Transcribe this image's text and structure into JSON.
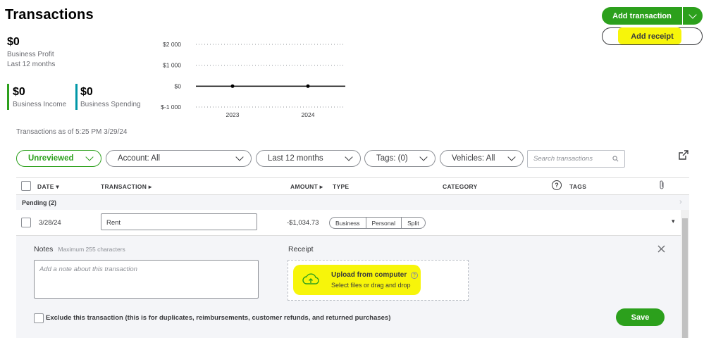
{
  "page": {
    "title": "Transactions"
  },
  "header_buttons": {
    "add_transaction": "Add transaction",
    "add_receipt": "Add receipt"
  },
  "summary": {
    "profit_value": "$0",
    "profit_label": "Business Profit",
    "profit_period": "Last 12 months",
    "income_value": "$0",
    "income_label": "Business Income",
    "spending_value": "$0",
    "spending_label": "Business Spending",
    "income_color": "#2ca01c",
    "spending_color": "#0097a7"
  },
  "chart_data": {
    "type": "line",
    "y_ticks": [
      "$2 000",
      "$1 000",
      "$0",
      "$-1 000"
    ],
    "x_labels": [
      "2023",
      "2024"
    ],
    "ylim": [
      -1000,
      2000
    ],
    "series": [
      {
        "values": [
          0,
          0
        ]
      }
    ],
    "grid": true
  },
  "as_of": "Transactions as of 5:25 PM 3/29/24",
  "filters": {
    "status": "Unreviewed",
    "account": "Account: All",
    "period": "Last 12 months",
    "tags": "Tags: (0)",
    "vehicles": "Vehicles: All",
    "search_placeholder": "Search transactions"
  },
  "table": {
    "headers": {
      "date": "DATE",
      "transaction": "TRANSACTION",
      "amount": "AMOUNT",
      "type": "TYPE",
      "category": "CATEGORY",
      "tags": "TAGS"
    },
    "group_label": "Pending (2)",
    "rows": [
      {
        "date": "3/28/24",
        "transaction": "Rent",
        "amount": "-$1,034.73",
        "types": [
          "Business",
          "Personal",
          "Split"
        ]
      }
    ]
  },
  "detail": {
    "notes_label": "Notes",
    "notes_hint": "Maximum 255 characters",
    "notes_placeholder": "Add a note about this transaction",
    "receipt_label": "Receipt",
    "upload_title": "Upload from computer",
    "upload_sub": "Select files or drag and drop",
    "exclude_label": "Exclude this transaction (this is for duplicates, reimbursements, customer refunds, and returned purchases)",
    "save_label": "Save"
  }
}
